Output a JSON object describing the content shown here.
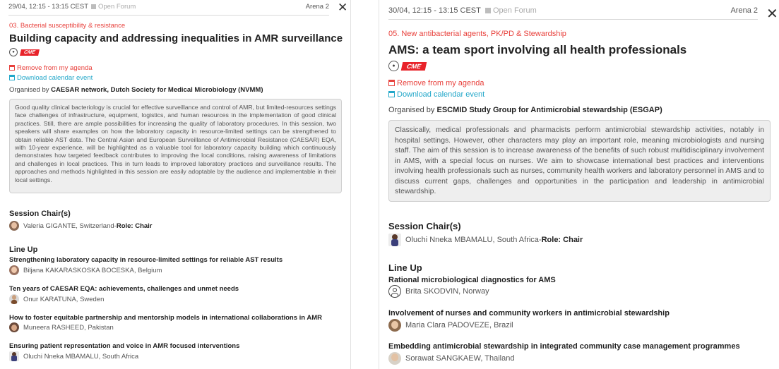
{
  "left": {
    "date_time": "29/04, 12:15 - 13:15 CEST",
    "forum": "Open Forum",
    "arena": "Arena 2",
    "close_symbol": "✕",
    "category": "03. Bacterial susceptibility & resistance",
    "title": "Building capacity and addressing inequalities in AMR surveillance",
    "cme_label": "CME",
    "remove_label": "Remove from my agenda",
    "download_label": "Download calendar event",
    "organised_by_label": "Organised by",
    "organiser": "CAESAR network, Dutch Society for Medical Microbiology (NVMM)",
    "abstract": "Good quality clinical bacteriology is crucial for effective surveillance and control of AMR, but limited-resources settings face challenges of infrastructure, equipment, logistics, and human resources in the implementation of good clinical practices. Still, there are ample possibilities for increasing the quality of laboratory procedures. In this session, two speakers will share examples on how the laboratory capacity in resource-limited settings can be strengthened to obtain reliable AST data. The Central Asian and European Surveillance of Antimicrobial Resistance (CAESAR) EQA, with 10-year experience, will be highlighted as a valuable tool for laboratory capacity building which continuously demonstrates how targeted feedback contributes to improving the local conditions, raising awareness of limitations and challenges in local practices. This in turn leads to improved laboratory practices and surveillance results. The approaches and methods highlighted in this session are easily adoptable by the audience and implementable in their local settings.",
    "chairs_heading": "Session Chair(s)",
    "chair": {
      "name": "Valeria GIGANTE, Switzerland",
      "separator": " - ",
      "role": "Role: Chair"
    },
    "lineup_heading": "Line Up",
    "talks": [
      {
        "title": "Strengthening laboratory capacity in resource-limited settings for reliable AST results",
        "speaker": "Biljana KAKARASKOSKA BOCESKA, Belgium"
      },
      {
        "title": "Ten years of CAESAR EQA: achievements, challenges and unmet needs",
        "speaker": "Onur KARATUNA, Sweden"
      },
      {
        "title": "How to foster equitable partnership and mentorship models in international collaborations in AMR",
        "speaker": "Muneera RASHEED, Pakistan"
      },
      {
        "title": "Ensuring patient representation and voice in AMR focused interventions",
        "speaker": "Oluchi Nneka MBAMALU, South Africa"
      }
    ]
  },
  "right": {
    "date_time": "30/04, 12:15 - 13:15 CEST",
    "forum": "Open Forum",
    "arena": "Arena 2",
    "close_symbol": "✕",
    "category": "05. New antibacterial agents, PK/PD & Stewardship",
    "title": "AMS: a team sport involving all health professionals",
    "cme_label": "CME",
    "remove_label": "Remove from my agenda",
    "download_label": "Download calendar event",
    "organised_by_label": "Organised by",
    "organiser": "ESCMID Study Group for Antimicrobial stewardship (ESGAP)",
    "abstract": "Classically, medical professionals and pharmacists perform antimicrobial stewardship activities, notably in hospital settings. However, other characters may play an important role, meaning microbiologists and nursing staff. The aim of this session is to increase awareness of the benefits of such robust multidisciplinary involvement in AMS, with a special focus on nurses. We aim to showcase international best practices and interventions involving health professionals such as nurses, community health workers and laboratory personnel in AMS and to discuss current gaps, challenges and opportunities in the participation and leadership in antimicrobial stewardship.",
    "chairs_heading": "Session Chair(s)",
    "chair": {
      "name": "Oluchi Nneka MBAMALU, South Africa",
      "separator": " - ",
      "role": "Role: Chair"
    },
    "lineup_heading": "Line Up",
    "talks": [
      {
        "title": "Rational microbiological diagnostics for AMS",
        "speaker": "Brita SKODVIN, Norway"
      },
      {
        "title": "Involvement of nurses and community workers in antimicrobial stewardship",
        "speaker": "Maria Clara PADOVEZE, Brazil"
      },
      {
        "title": "Embedding antimicrobial stewardship in integrated community case management programmes",
        "speaker": "Sorawat SANGKAEW, Thailand"
      }
    ]
  },
  "colors": {
    "accent_red": "#e8413c",
    "link_teal": "#22a7c9",
    "cme_red": "#e8232a",
    "abstract_bg": "#eeeeee"
  }
}
